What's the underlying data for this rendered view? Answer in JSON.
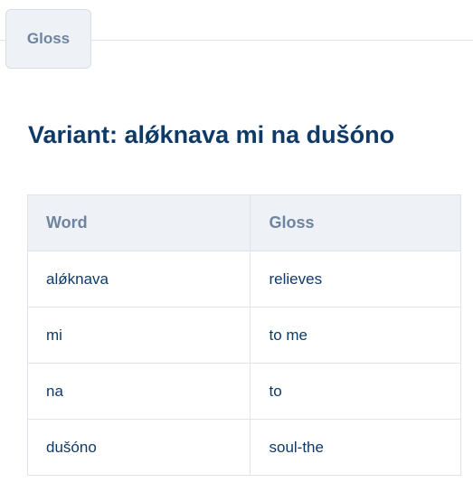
{
  "tabs": [
    {
      "label": "Gloss",
      "active": true
    }
  ],
  "heading": "Variant: alǿknava mi na dušóno",
  "table": {
    "headers": [
      "Word",
      "Gloss"
    ],
    "rows": [
      {
        "word": "alǿknava",
        "gloss": "relieves"
      },
      {
        "word": "mi",
        "gloss": "to me"
      },
      {
        "word": "na",
        "gloss": "to"
      },
      {
        "word": "dušóno",
        "gloss": "soul-the"
      }
    ]
  },
  "colors": {
    "heading": "#0f3a68",
    "tab_text": "#6f849e",
    "tab_bg": "#eef2f7",
    "border": "#dfe3ea"
  }
}
